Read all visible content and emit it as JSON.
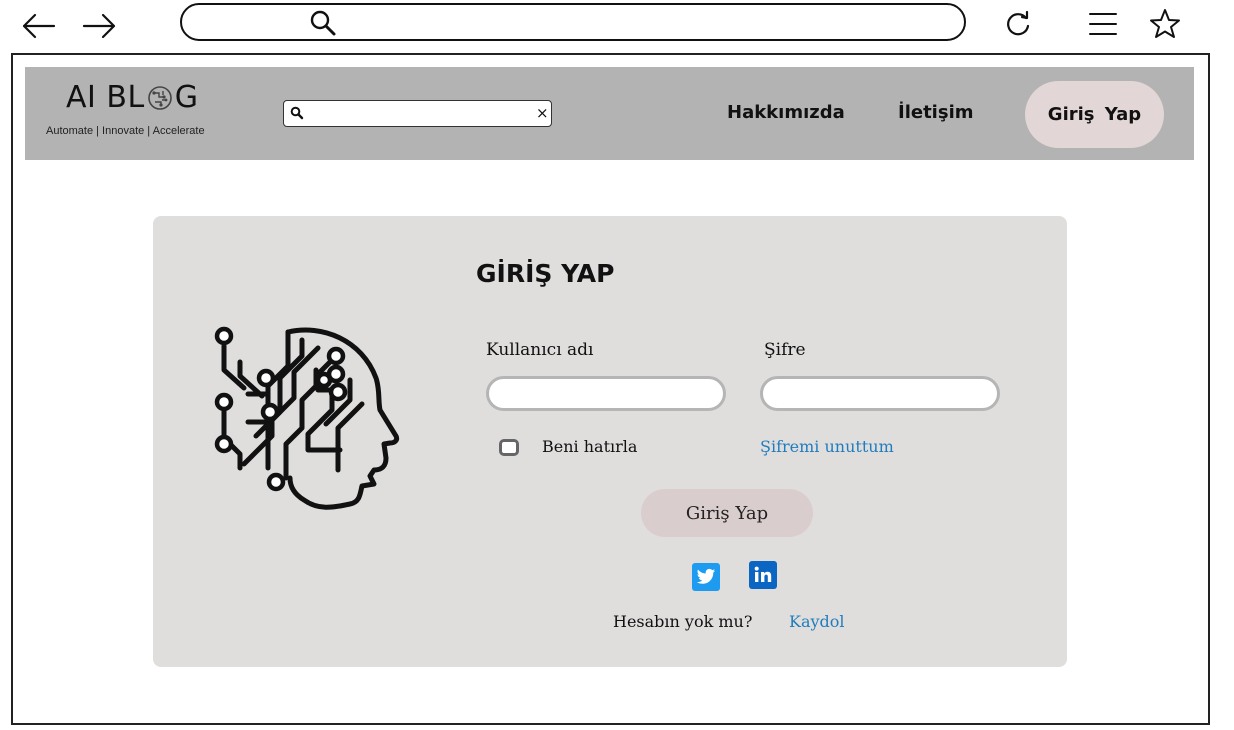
{
  "browser": {
    "back_icon": "arrow-left-icon",
    "forward_icon": "arrow-right-icon",
    "search_icon": "search-icon",
    "reload_icon": "reload-icon",
    "menu_icon": "hamburger-menu-icon",
    "bookmark_icon": "star-icon"
  },
  "header": {
    "logo_text": "AI BL",
    "logo_text_end": "G",
    "logo_icon": "brain-circuit-icon",
    "tagline": "Automate | Innovate | Accelerate",
    "search_icon": "search-icon",
    "search_clear": "×",
    "nav": [
      {
        "label": "Hakkımızda"
      },
      {
        "label": "İletişim"
      }
    ],
    "login_label": "Giriş Yap"
  },
  "login": {
    "title": "GİRİŞ YAP",
    "illustration_icon": "ai-head-circuit-icon",
    "username_label": "Kullanıcı adı",
    "password_label": "Şifre",
    "remember_label": "Beni hatırla",
    "forgot_label": "Şifremi unuttum",
    "submit_label": "Giriş Yap",
    "no_account_label": "Hesabın yok mu?",
    "register_label": "Kaydol"
  },
  "social": [
    {
      "icon": "twitter-icon",
      "color": "#1d9bf0"
    },
    {
      "icon": "linkedin-icon",
      "color": "#0a66c2"
    }
  ],
  "colors": {
    "header_bg": "#b3b3b3",
    "card_bg": "#e0dddd",
    "button_bg": "#e2d6d6",
    "link": "#1f7dbd"
  }
}
